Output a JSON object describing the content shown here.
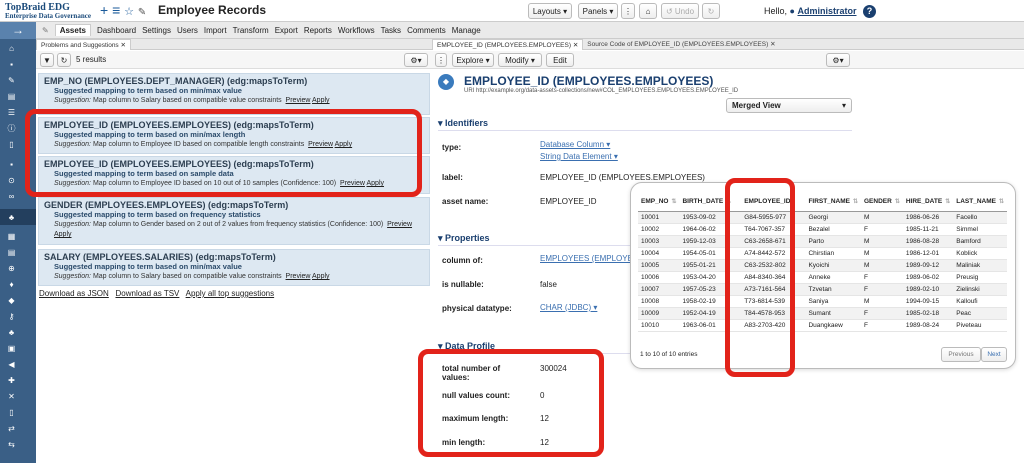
{
  "app": {
    "logo_line1": "TopBraid EDG",
    "logo_line2": "Enterprise Data Governance",
    "title": "Employee Records",
    "hello": "Hello,",
    "user": "Administrator"
  },
  "topbuttons": {
    "layouts": "Layouts ▾",
    "panels": "Panels ▾",
    "more": "⋮",
    "home": "⌂",
    "undo": "Undo",
    "redo": "↻"
  },
  "menu": [
    "Assets",
    "Dashboard",
    "Settings",
    "Users",
    "Import",
    "Transform",
    "Export",
    "Reports",
    "Workflows",
    "Tasks",
    "Comments",
    "Manage"
  ],
  "left": {
    "tab": "Problems and Suggestions ✕",
    "results": "5 results",
    "suggestions": [
      {
        "title": "EMP_NO (EMPLOYEES.DEPT_MANAGER) (edg:mapsToTerm)",
        "subtitle": "Suggested mapping to term based on min/max value",
        "prefix": "Suggestion:",
        "detail": "Map column to Salary based on compatible value constraints",
        "preview": "Preview",
        "apply": "Apply"
      },
      {
        "title": "EMPLOYEE_ID (EMPLOYEES.EMPLOYEES) (edg:mapsToTerm)",
        "subtitle": "Suggested mapping to term based on min/max length",
        "prefix": "Suggestion:",
        "detail": "Map column to Employee ID based on compatible length constraints",
        "preview": "Preview",
        "apply": "Apply"
      },
      {
        "title": "EMPLOYEE_ID (EMPLOYEES.EMPLOYEES) (edg:mapsToTerm)",
        "subtitle": "Suggested mapping to term based on sample data",
        "prefix": "Suggestion:",
        "detail": "Map column to Employee ID based on 10 out of 10 samples (Confidence: 100)",
        "preview": "Preview",
        "apply": "Apply"
      },
      {
        "title": "GENDER (EMPLOYEES.EMPLOYEES) (edg:mapsToTerm)",
        "subtitle": "Suggested mapping to term based on frequency statistics",
        "prefix": "Suggestion:",
        "detail": "Map column to Gender based on 2 out of 2 values from frequency statistics (Confidence: 100)",
        "preview": "Preview",
        "apply": "Apply"
      },
      {
        "title": "SALARY (EMPLOYEES.SALARIES) (edg:mapsToTerm)",
        "subtitle": "Suggested mapping to term based on min/max value",
        "prefix": "Suggestion:",
        "detail": "Map column to Salary based on compatible value constraints",
        "preview": "Preview",
        "apply": "Apply"
      }
    ],
    "footer_links": [
      "Download as JSON",
      "Download as TSV",
      "Apply all top suggestions"
    ]
  },
  "right": {
    "tab1": "EMPLOYEE_ID (EMPLOYEES.EMPLOYEES) ✕",
    "tab2": "Source Code of EMPLOYEE_ID (EMPLOYEES.EMPLOYEES) ✕",
    "explore": "Explore ▾",
    "modify": "Modify ▾",
    "edit": "Edit",
    "resource_title": "EMPLOYEE_ID (EMPLOYEES.EMPLOYEES)",
    "uri_label": "URI",
    "uri": "http://example.org/data-assets-collections/new#COL_EMPLOYEES.EMPLOYEES.EMPLOYEE_ID",
    "view": "Merged View",
    "sections": {
      "identifiers": "Identifiers",
      "properties": "Properties",
      "profile": "Data Profile"
    },
    "props": {
      "type_label": "type:",
      "type_val1": "Database Column ▾",
      "type_val2": "String Data Element ▾",
      "label_label": "label:",
      "label_val": "EMPLOYEE_ID (EMPLOYEES.EMPLOYEES)",
      "asset_label": "asset name:",
      "asset_val": "EMPLOYEE_ID",
      "column_label": "column of:",
      "column_val": "EMPLOYEES (EMPLOYEES) ▾",
      "nullable_label": "is nullable:",
      "nullable_val": "false",
      "dtype_label": "physical datatype:",
      "dtype_val": "CHAR (JDBC) ▾",
      "total_label": "total number of values:",
      "total_val": "300024",
      "null_label": "null values count:",
      "null_val": "0",
      "max_label": "maximum length:",
      "max_val": "12",
      "min_label": "min length:",
      "min_val": "12"
    }
  },
  "sample_table": {
    "headers": [
      "EMP_NO",
      "BIRTH_DATE",
      "EMPLOYEE_ID",
      "FIRST_NAME",
      "GENDER",
      "HIRE_DATE",
      "LAST_NAME"
    ],
    "rows": [
      [
        "10001",
        "1953-09-02",
        "G84-5955-977",
        "Georgi",
        "M",
        "1986-06-26",
        "Facello"
      ],
      [
        "10002",
        "1964-06-02",
        "T64-7067-357",
        "Bezalel",
        "F",
        "1985-11-21",
        "Simmel"
      ],
      [
        "10003",
        "1959-12-03",
        "C63-2658-671",
        "Parto",
        "M",
        "1986-08-28",
        "Bamford"
      ],
      [
        "10004",
        "1954-05-01",
        "A74-8442-572",
        "Chirstian",
        "M",
        "1986-12-01",
        "Koblick"
      ],
      [
        "10005",
        "1955-01-21",
        "C63-2532-802",
        "Kyoichi",
        "M",
        "1989-09-12",
        "Maliniak"
      ],
      [
        "10006",
        "1953-04-20",
        "A84-8340-364",
        "Anneke",
        "F",
        "1989-06-02",
        "Preusig"
      ],
      [
        "10007",
        "1957-05-23",
        "A73-7161-564",
        "Tzvetan",
        "F",
        "1989-02-10",
        "Zielinski"
      ],
      [
        "10008",
        "1958-02-19",
        "T73-6814-539",
        "Saniya",
        "M",
        "1994-09-15",
        "Kalloufi"
      ],
      [
        "10009",
        "1952-04-19",
        "T84-4578-953",
        "Sumant",
        "F",
        "1985-02-18",
        "Peac"
      ],
      [
        "10010",
        "1963-06-01",
        "A83-2703-420",
        "Duangkaew",
        "F",
        "1989-08-24",
        "Piveteau"
      ]
    ],
    "info": "1 to 10 of 10 entries",
    "previous": "Previous",
    "next": "Next"
  },
  "colors": {
    "sidebar": "#3a5f86",
    "highlight": "#e2231a",
    "suggestion_bg": "#dde8f2",
    "link": "#3a6fb0"
  }
}
